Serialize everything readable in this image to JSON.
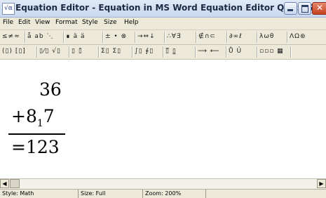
{
  "window": {
    "app_icon": "√α",
    "title": "Equation Editor - Equation in MS Word Equation Editor Quick Gu…"
  },
  "menu": {
    "items": [
      "File",
      "Edit",
      "View",
      "Format",
      "Style",
      "Size",
      "Help"
    ]
  },
  "toolbar_symbols": [
    "≤≠≈",
    "ǟ ab ⋱",
    "∎ ä ä",
    "± • ⊗",
    "→⇔↓",
    "∴∀∃",
    "∉∩⊂",
    "∂∞ℓ",
    "λωθ",
    "ΛΩ⊛"
  ],
  "toolbar_templates": [
    "(▯) [▯]",
    "▯⁄▯ √▯",
    "▯ ▯̈",
    "Σ▯ Σ▯",
    "∫▯ ∮▯",
    "▯̅ ▯̲",
    "⟶ ⟵",
    "Ů Ủ",
    "▫▫▫ ▦"
  ],
  "editor": {
    "line1": "36",
    "line2_sign": "+",
    "line2_int": "8",
    "line2_sub": "1",
    "line2_frac": "7",
    "line3": "=123"
  },
  "scrollbar": {
    "left_arrow": "◀",
    "right_arrow": "▶"
  },
  "status": {
    "style": "Style: Math",
    "size": "Size: Full",
    "zoom": "Zoom: 200%"
  }
}
